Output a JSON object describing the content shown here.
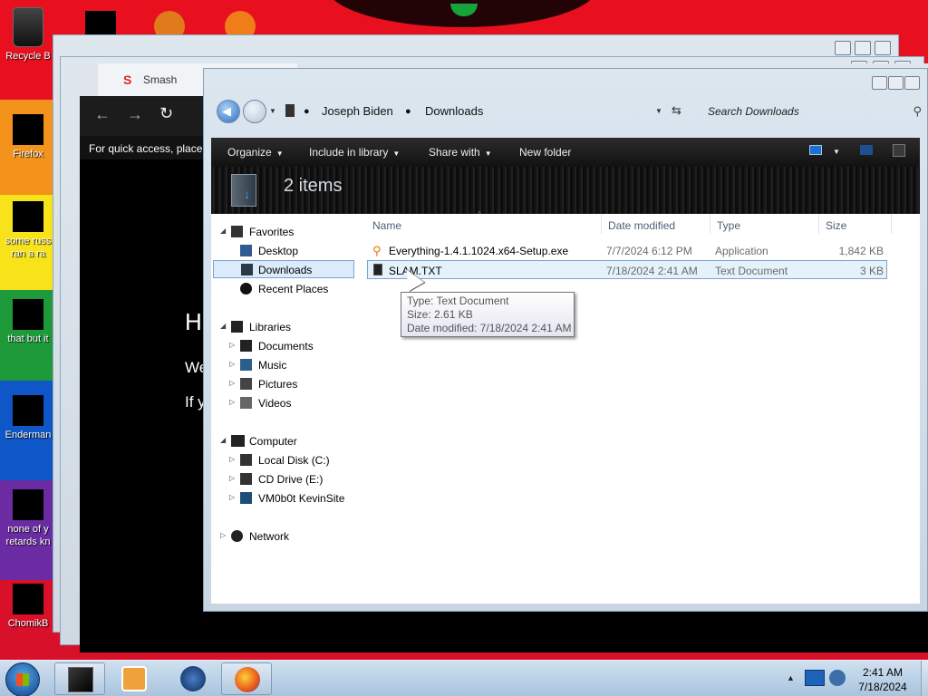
{
  "desktop": {
    "icons": [
      {
        "label": "Recycle B"
      },
      {
        "label": "Firefox"
      },
      {
        "label": "some russ"
      },
      {
        "label": "ran a ra"
      },
      {
        "label": "that but it"
      },
      {
        "label": "Enderman"
      },
      {
        "label": "none of y"
      },
      {
        "label": "retards kn"
      },
      {
        "label": "ChomikB"
      }
    ]
  },
  "browser": {
    "tab_title": "Smash",
    "quick_access_text": "For quick access, place y",
    "heading_fragment": "H",
    "line1_fragment": "We",
    "line2_fragment": "If y"
  },
  "explorer": {
    "breadcrumb": [
      "Joseph Biden",
      "Downloads"
    ],
    "search_placeholder": "Search Downloads",
    "toolbar": {
      "organize": "Organize",
      "include_in_library": "Include in library",
      "share_with": "Share with",
      "new_folder": "New folder"
    },
    "item_count": "2 items",
    "nav": {
      "favorites": "Favorites",
      "desktop": "Desktop",
      "downloads": "Downloads",
      "recent_places": "Recent Places",
      "libraries": "Libraries",
      "documents": "Documents",
      "music": "Music",
      "pictures": "Pictures",
      "videos": "Videos",
      "computer": "Computer",
      "local_disk": "Local Disk (C:)",
      "cd_drive": "CD Drive (E:)",
      "share": "VM0b0t KevinSite",
      "network": "Network"
    },
    "columns": {
      "name": "Name",
      "date_modified": "Date modified",
      "type": "Type",
      "size": "Size"
    },
    "files": [
      {
        "name": "Everything-1.4.1.1024.x64-Setup.exe",
        "date": "7/7/2024 6:12 PM",
        "type": "Application",
        "size": "1,842 KB"
      },
      {
        "name": "SLAM.TXT",
        "date": "7/18/2024 2:41 AM",
        "type": "Text Document",
        "size": "3 KB"
      }
    ],
    "tooltip": {
      "type": "Type: Text Document",
      "size": "Size: 2.61 KB",
      "modified": "Date modified: 7/18/2024 2:41 AM"
    }
  },
  "taskbar": {
    "time": "2:41 AM",
    "date": "7/18/2024"
  }
}
